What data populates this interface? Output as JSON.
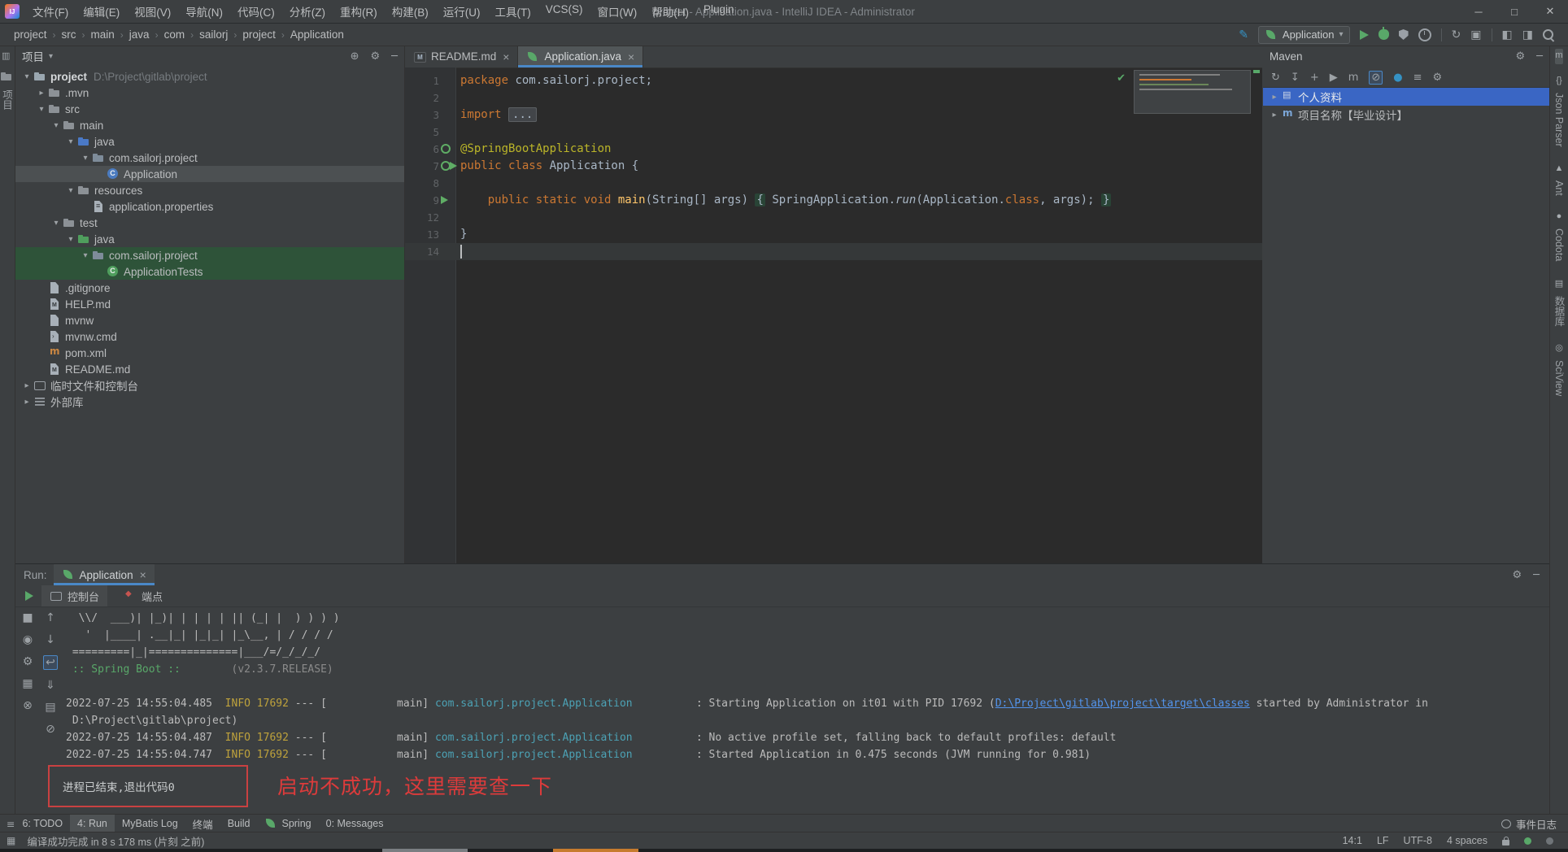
{
  "window": {
    "title": "project - Application.java - IntelliJ IDEA - Administrator",
    "menus": [
      "文件(F)",
      "编辑(E)",
      "视图(V)",
      "导航(N)",
      "代码(C)",
      "分析(Z)",
      "重构(R)",
      "构建(B)",
      "运行(U)",
      "工具(T)",
      "VCS(S)",
      "窗口(W)",
      "帮助(H)",
      "Plugin"
    ]
  },
  "colors": {
    "accent_blue": "#4A88C7",
    "run_green": "#59A869",
    "selection_blue": "#3A66C4",
    "test_green_bg": "#2E5339",
    "annotation_red": "#DD3B3B"
  },
  "navbar": {
    "breadcrumbs": [
      "project",
      "src",
      "main",
      "java",
      "com",
      "sailorj",
      "project",
      "Application"
    ],
    "run_config": "Application",
    "actions": [
      "pencil",
      "run-config",
      "run",
      "debug",
      "coverage",
      "profiler",
      "divider",
      "update",
      "package",
      "divider",
      "layout-left",
      "layout-right",
      "search"
    ]
  },
  "left_stripe": {
    "icons": [
      "screen",
      "folder"
    ],
    "tab_label": "项目"
  },
  "project": {
    "header": "项目",
    "header_icons": [
      "locate",
      "settings",
      "hide"
    ],
    "rows": [
      {
        "depth": 0,
        "chev": "v",
        "icon": "project",
        "label": "project",
        "detail": "D:\\Project\\gitlab\\project",
        "bold": true
      },
      {
        "depth": 1,
        "chev": ">",
        "icon": "folder",
        "label": ".mvn"
      },
      {
        "depth": 1,
        "chev": "v",
        "icon": "folder",
        "label": "src"
      },
      {
        "depth": 2,
        "chev": "v",
        "icon": "folder",
        "label": "main"
      },
      {
        "depth": 3,
        "chev": "v",
        "icon": "srcfolder",
        "label": "java"
      },
      {
        "depth": 4,
        "chev": "v",
        "icon": "package",
        "label": "com.sailorj.project"
      },
      {
        "depth": 5,
        "chev": "",
        "icon": "class",
        "label": "Application",
        "bg": "sel"
      },
      {
        "depth": 3,
        "chev": "v",
        "icon": "resfolder",
        "label": "resources"
      },
      {
        "depth": 4,
        "chev": "",
        "icon": "propfile",
        "label": "application.properties"
      },
      {
        "depth": 2,
        "chev": "v",
        "icon": "folder",
        "label": "test"
      },
      {
        "depth": 3,
        "chev": "v",
        "icon": "testfolder",
        "label": "java"
      },
      {
        "depth": 4,
        "chev": "v",
        "icon": "package",
        "label": "com.sailorj.project",
        "bg": "green"
      },
      {
        "depth": 5,
        "chev": "",
        "icon": "testclass",
        "label": "ApplicationTests",
        "bg": "green"
      },
      {
        "depth": 1,
        "chev": "",
        "icon": "file",
        "label": ".gitignore"
      },
      {
        "depth": 1,
        "chev": "",
        "icon": "mdfile",
        "label": "HELP.md"
      },
      {
        "depth": 1,
        "chev": "",
        "icon": "file",
        "label": "mvnw"
      },
      {
        "depth": 1,
        "chev": "",
        "icon": "cmdfile",
        "label": "mvnw.cmd"
      },
      {
        "depth": 1,
        "chev": "",
        "icon": "maven",
        "label": "pom.xml"
      },
      {
        "depth": 1,
        "chev": "",
        "icon": "mdfile",
        "label": "README.md"
      },
      {
        "depth": 0,
        "chev": ">",
        "icon": "consoleic",
        "label": "临时文件和控制台"
      },
      {
        "depth": 0,
        "chev": ">",
        "icon": "lib",
        "label": "外部库"
      }
    ]
  },
  "editor": {
    "tabs": [
      {
        "label": "README.md",
        "icon": "md",
        "active": false
      },
      {
        "label": "Application.java",
        "icon": "leaf",
        "active": true
      }
    ],
    "lines": [
      {
        "n": "1",
        "seg": [
          [
            "kw",
            "package "
          ],
          [
            "pl",
            "com.sailorj.project;"
          ]
        ]
      },
      {
        "n": "2",
        "seg": []
      },
      {
        "n": "3",
        "seg": [
          [
            "kw",
            "import "
          ],
          [
            "fold",
            "..."
          ]
        ]
      },
      {
        "n": "5",
        "seg": []
      },
      {
        "n": "6",
        "seg": [
          [
            "ann",
            "@SpringBootApplication"
          ]
        ],
        "gutter": [
          "bean"
        ]
      },
      {
        "n": "7",
        "seg": [
          [
            "kw",
            "public class "
          ],
          [
            "pl",
            "Application {"
          ]
        ],
        "gutter": [
          "bean",
          "run"
        ]
      },
      {
        "n": "8",
        "seg": []
      },
      {
        "n": "9",
        "seg": [
          [
            "pl",
            "    "
          ],
          [
            "kw",
            "public static void "
          ],
          [
            "meth",
            "main"
          ],
          [
            "pl",
            "(String[] args) "
          ],
          [
            "foldg",
            "{"
          ],
          [
            "pl",
            " SpringApplication."
          ],
          [
            "it",
            "run"
          ],
          [
            "pl",
            "(Application."
          ],
          [
            "kw",
            "class"
          ],
          [
            "pl",
            ", args); "
          ],
          [
            "foldg",
            "}"
          ]
        ],
        "gutter": [
          "run"
        ]
      },
      {
        "n": "12",
        "seg": []
      },
      {
        "n": "13",
        "seg": [
          [
            "pl",
            "}"
          ]
        ]
      },
      {
        "n": "14",
        "seg": [],
        "current": true
      }
    ]
  },
  "maven": {
    "title": "Maven",
    "header_icons": [
      "settings",
      "hide"
    ],
    "toolbar": [
      "refresh",
      "download",
      "add",
      "play",
      "m-goal",
      "skip-tests",
      "offline",
      "list",
      "settings"
    ],
    "items": [
      {
        "chev": ">",
        "icon": "profiles",
        "label": "个人资料",
        "selected": true
      },
      {
        "chev": ">",
        "icon": "mproject",
        "label": "项目名称【毕业设计】"
      }
    ]
  },
  "right_stripe": [
    {
      "icon": "m",
      "label": "",
      "active": true
    },
    {
      "icon": "braces",
      "label": "Json Parser"
    },
    {
      "icon": "ant",
      "label": "Ant"
    },
    {
      "icon": "dot",
      "label": "Codota"
    },
    {
      "icon": "db",
      "label": "数据库"
    },
    {
      "icon": "eye",
      "label": "SciView"
    }
  ],
  "run": {
    "label": "Run:",
    "tab": "Application",
    "header_icons": [
      "settings",
      "hide"
    ],
    "view_tabs": [
      {
        "label": "控制台",
        "icon": "consoleic",
        "active": true
      },
      {
        "label": "端点",
        "icon": "endpoint",
        "active": false
      }
    ],
    "toolbar_a": [
      "stop",
      "thread-dump",
      "settings",
      "restore-layout",
      "close"
    ],
    "toolbar_b": [
      "up",
      "down",
      "soft-wrap",
      "scroll-end",
      "print",
      "clear"
    ],
    "console_lines": [
      {
        "seg": [
          [
            "w",
            "  \\\\/  ___)| |_)| | | | | || (_| |  ) ) ) )"
          ]
        ]
      },
      {
        "seg": [
          [
            "w",
            "   '  |____| .__|_| |_|_| |_\\__, | / / / /"
          ]
        ]
      },
      {
        "seg": [
          [
            "w",
            " =========|_|==============|___/=/_/_/_/"
          ]
        ]
      },
      {
        "seg": [
          [
            "g",
            " :: Spring Boot ::"
          ],
          [
            "gray",
            "        (v2.3.7.RELEASE)"
          ]
        ]
      },
      {
        "seg": []
      },
      {
        "seg": [
          [
            "w",
            "2022-07-25 14:55:04.485"
          ],
          [
            "y",
            "  INFO 17692"
          ],
          [
            "w",
            " --- ["
          ],
          [
            "w",
            "           main] "
          ],
          [
            "t",
            "com.sailorj.project.Application         "
          ],
          [
            "w",
            " : Starting Application on it01 with PID 17692 ("
          ],
          [
            "link",
            "D:\\Project\\gitlab\\project\\target\\classes"
          ],
          [
            "w",
            " started by Administrator in"
          ]
        ]
      },
      {
        "seg": [
          [
            "w",
            " D:\\Project\\gitlab\\project)"
          ]
        ]
      },
      {
        "seg": [
          [
            "w",
            "2022-07-25 14:55:04.487"
          ],
          [
            "y",
            "  INFO 17692"
          ],
          [
            "w",
            " --- ["
          ],
          [
            "w",
            "           main] "
          ],
          [
            "t",
            "com.sailorj.project.Application         "
          ],
          [
            "w",
            " : No active profile set, falling back to default profiles: default"
          ]
        ]
      },
      {
        "seg": [
          [
            "w",
            "2022-07-25 14:55:04.747"
          ],
          [
            "y",
            "  INFO 17692"
          ],
          [
            "w",
            " --- ["
          ],
          [
            "w",
            "           main] "
          ],
          [
            "t",
            "com.sailorj.project.Application         "
          ],
          [
            "w",
            " : Started Application in 0.475 seconds (JVM running for 0.981)"
          ]
        ]
      }
    ],
    "exit_message": "进程已结束,退出代码0",
    "annotation": "启动不成功，这里需要查一下"
  },
  "bottom_bar": {
    "items": [
      {
        "label": "6: TODO"
      },
      {
        "label": "4: Run",
        "active": true
      },
      {
        "label": "MyBatis Log"
      },
      {
        "label": "终端"
      },
      {
        "label": "Build"
      },
      {
        "label": "Spring",
        "icon": "leaf"
      },
      {
        "label": "0: Messages"
      }
    ],
    "event_log": "事件日志"
  },
  "status_bar": {
    "message": "编译成功完成 in 8 s 178 ms (片刻 之前)",
    "caret": "14:1",
    "line_ending": "LF",
    "encoding": "UTF-8",
    "indent": "4 spaces",
    "icons": [
      "lock",
      "green-dot",
      "gray-dot"
    ]
  }
}
